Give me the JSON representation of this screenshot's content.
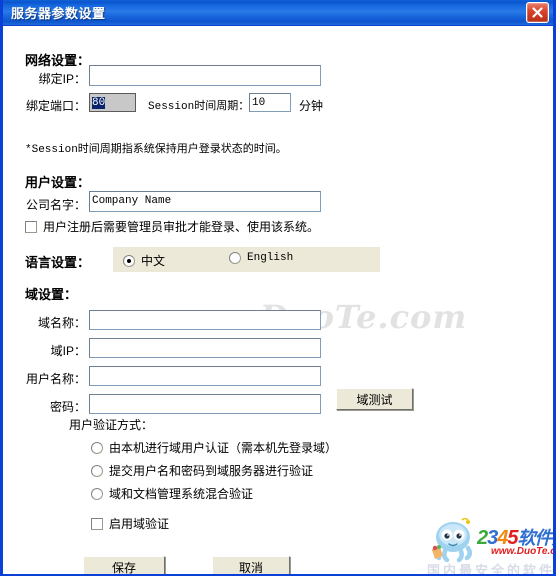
{
  "window": {
    "title": "服务器参数设置",
    "close_icon": "close-icon"
  },
  "network": {
    "heading": "网络设置：",
    "bind_ip_label": "绑定IP：",
    "bind_ip_value": "",
    "bind_port_label": "绑定端口：",
    "bind_port_value": "80",
    "session_label": "Session时间周期：",
    "session_value": "10",
    "session_unit": "分钟",
    "note": "*Session时间周期指系统保持用户登录状态的时间。"
  },
  "user": {
    "heading": "用户设置：",
    "company_label": "公司名字：",
    "company_value": "Company Name",
    "approve_checkbox_label": "用户注册后需要管理员审批才能登录、使用该系统。",
    "approve_checked": false
  },
  "language": {
    "heading": "语言设置：",
    "options": [
      {
        "label": "中文",
        "selected": true
      },
      {
        "label": "English",
        "selected": false
      }
    ]
  },
  "domain": {
    "heading": "域设置：",
    "fields": [
      {
        "label": "域名称：",
        "value": ""
      },
      {
        "label": "域IP：",
        "value": ""
      },
      {
        "label": "用户名称：",
        "value": ""
      },
      {
        "label": "密码：",
        "value": ""
      }
    ],
    "test_button": "域测试",
    "auth_heading": "用户验证方式：",
    "auth_options": [
      {
        "label": "由本机进行域用户认证（需本机先登录域）",
        "selected": false
      },
      {
        "label": "提交用户名和密码到域服务器进行验证",
        "selected": false
      },
      {
        "label": "域和文档管理系统混合验证",
        "selected": false
      }
    ],
    "enable_checkbox_label": "启用域验证",
    "enable_checked": false
  },
  "actions": {
    "save_label": "保存",
    "cancel_label": "取消"
  },
  "watermark": {
    "center_text": "www.DuoTe.com",
    "logo_digits": [
      "2",
      "3",
      "4",
      "5"
    ],
    "logo_cn": "软件大全",
    "logo_url": "www.DuoTe.com",
    "logo_slogan": "国内最安全的软件站"
  },
  "colors": {
    "title_bar": "#1063d6",
    "window_border": "#0a3fd8",
    "close_button": "#d8442a",
    "panel_bg": "#ece9d8",
    "selection": "#0a246a"
  }
}
